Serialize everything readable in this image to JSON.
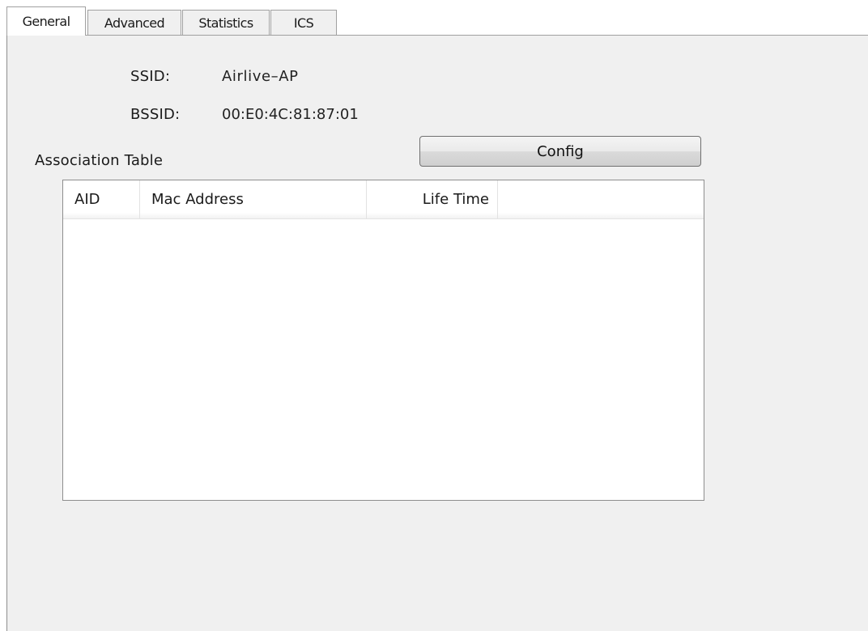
{
  "tabs": [
    {
      "label": "General",
      "active": true
    },
    {
      "label": "Advanced",
      "active": false
    },
    {
      "label": "Statistics",
      "active": false
    },
    {
      "label": "ICS",
      "active": false
    }
  ],
  "info": {
    "ssid_label": "SSID:",
    "ssid_value": "Airlive–AP",
    "bssid_label": "BSSID:",
    "bssid_value": "00:E0:4C:81:87:01"
  },
  "association": {
    "title": "Association Table",
    "config_label": "Config",
    "columns": [
      "AID",
      "Mac Address",
      "Life Time",
      ""
    ],
    "rows": []
  }
}
